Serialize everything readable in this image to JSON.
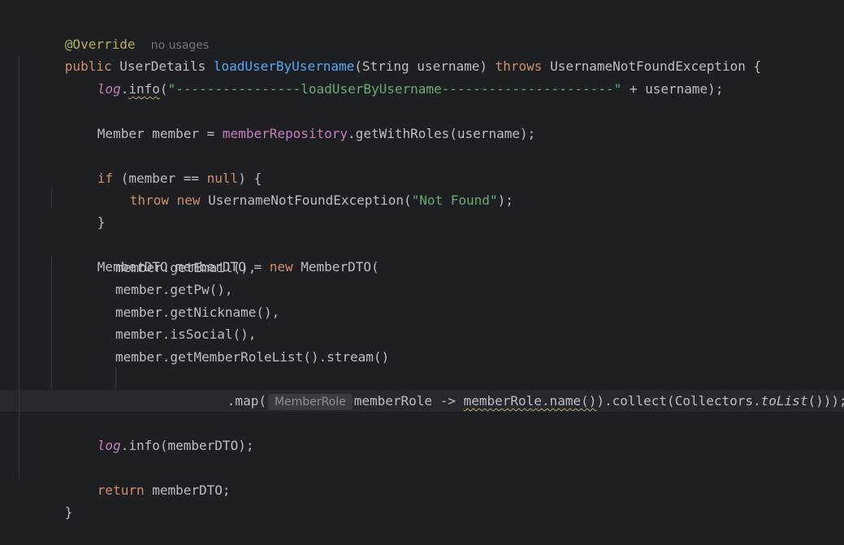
{
  "editor": {
    "line1": {
      "annotation": "@Override",
      "hint": "no usages"
    },
    "line2": {
      "kw_public": "public",
      "type": "UserDetails",
      "method": "loadUserByUsername",
      "params": "(String username)",
      "kw_throws": "throws",
      "exception": "UsernameNotFoundException {"
    },
    "line3": {
      "log": "log",
      "dot": ".",
      "info": "info",
      "paren": "(",
      "string": "\"----------------loadUserByUsername----------------------\"",
      "rest": " + username);"
    },
    "line4": {
      "decl": "Member member = ",
      "field": "memberRepository",
      "rest": ".getWithRoles(username);"
    },
    "line5": {
      "kw_if": "if",
      "cond": " (member == ",
      "kw_null": "null",
      "rest": ") {"
    },
    "line6": {
      "kw_throw": "throw",
      "kw_new": "new",
      "rest": " UsernameNotFoundException(",
      "string": "\"Not Found\"",
      "end": ");"
    },
    "line7": {
      "text": "}"
    },
    "line8": {
      "decl": "MemberDTO memberDTO = ",
      "kw_new": "new",
      "rest": " MemberDTO("
    },
    "line9": {
      "text": "member.getEmail(),"
    },
    "line10": {
      "text": "member.getPw(),"
    },
    "line11": {
      "text": "member.getNickname(),"
    },
    "line12": {
      "text": "member.isSocial(),"
    },
    "line13": {
      "text": "member.getMemberRoleList().stream()"
    },
    "line14": {
      "map": ".map(",
      "inlay_hint": "MemberRole",
      "lambda": "memberRole -> ",
      "name_call": "memberRole.name()",
      "collect": ").collect(Collectors.",
      "tolist": "toList",
      "end": "()));"
    },
    "line15": {
      "log": "log",
      "rest": ".info(memberDTO);"
    },
    "line16": {
      "kw_return": "return",
      "rest": " memberDTO;"
    },
    "line17": {
      "text": "}"
    }
  }
}
